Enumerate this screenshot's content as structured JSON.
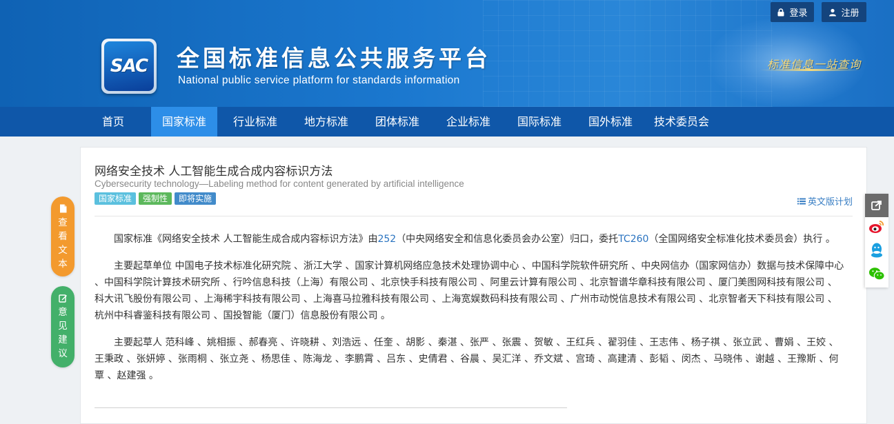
{
  "header": {
    "login_label": "登录",
    "register_label": "注册",
    "logo_text": "SAC",
    "title_cn": "全国标准信息公共服务平台",
    "title_en": "National public service platform  for standards information",
    "slogan": "标准信息一站查询"
  },
  "nav": {
    "items": [
      {
        "label": "首页"
      },
      {
        "label": "国家标准"
      },
      {
        "label": "行业标准"
      },
      {
        "label": "地方标准"
      },
      {
        "label": "团体标准"
      },
      {
        "label": "企业标准"
      },
      {
        "label": "国际标准"
      },
      {
        "label": "国外标准"
      },
      {
        "label": "技术委员会"
      }
    ],
    "active_index": 1
  },
  "document": {
    "title": "网络安全技术 人工智能生成合成内容标识方法",
    "subtitle": "Cybersecurity technology—Labeling method for content generated by artificial intelligence",
    "tags": [
      "国家标准",
      "强制性",
      "即将实施"
    ],
    "english_plan_label": "英文版计划",
    "para1": {
      "pre": "国家标准《网络安全技术 人工智能生成合成内容标识方法》由",
      "link1": "252",
      "mid": "（中央网络安全和信息化委员会办公室）归口，委托",
      "link2": "TC260",
      "post": "（全国网络安全标准化技术委员会）执行 。"
    },
    "para2": "主要起草单位 中国电子技术标准化研究院 、浙江大学 、国家计算机网络应急技术处理协调中心 、中国科学院软件研究所 、中央网信办（国家网信办）数据与技术保障中心 、中国科学院计算技术研究所 、行吟信息科技（上海）有限公司 、北京快手科技有限公司 、阿里云计算有限公司 、北京智谱华章科技有限公司 、厦门美图网科技有限公司 、科大讯飞股份有限公司 、上海稀宇科技有限公司 、上海喜马拉雅科技有限公司 、上海宽娱数码科技有限公司 、广州市动悦信息技术有限公司 、北京智者天下科技有限公司 、杭州中科睿鉴科技有限公司 、国投智能（厦门）信息股份有限公司 。",
    "para3": "主要起草人 范科峰 、姚相振 、郝春亮 、许晓耕 、刘浩远 、任奎 、胡影 、秦湛 、张严 、张震 、贺敏 、王红兵 、翟羽佳 、王志伟 、杨子祺 、张立武 、曹娟 、王姣 、王秉政 、张妍婷 、张雨桐 、张立尧 、杨思佳 、陈海龙 、李鹏霄 、吕东 、史倩君 、谷晨 、吴汇洋 、乔文斌 、宫琦 、高建清 、彭韬 、闵杰 、马晓伟 、谢越 、王豫斯 、何覃 、赵建强 。"
  },
  "sidebar_left": {
    "view_text_label": [
      "查",
      "看",
      "文",
      "本"
    ],
    "feedback_label": [
      "意",
      "见",
      "建",
      "议"
    ]
  },
  "icons": {
    "login": "lock-icon",
    "register": "user-icon",
    "english_plan": "list-icon",
    "view_text": "file-icon",
    "feedback": "edit-icon",
    "share_toggle": "share-icon",
    "weibo": "weibo-icon",
    "qq": "qq-icon",
    "wechat": "wechat-icon"
  },
  "colors": {
    "nav_bg": "#0f57a9",
    "nav_active": "#2d8ee8",
    "tag_national": "#5bc0de",
    "tag_mandatory": "#5cb85c",
    "tag_upcoming": "#428bca",
    "view_btn": "#f39a2e",
    "feedback_btn": "#43b06a",
    "link": "#2a73c0"
  }
}
